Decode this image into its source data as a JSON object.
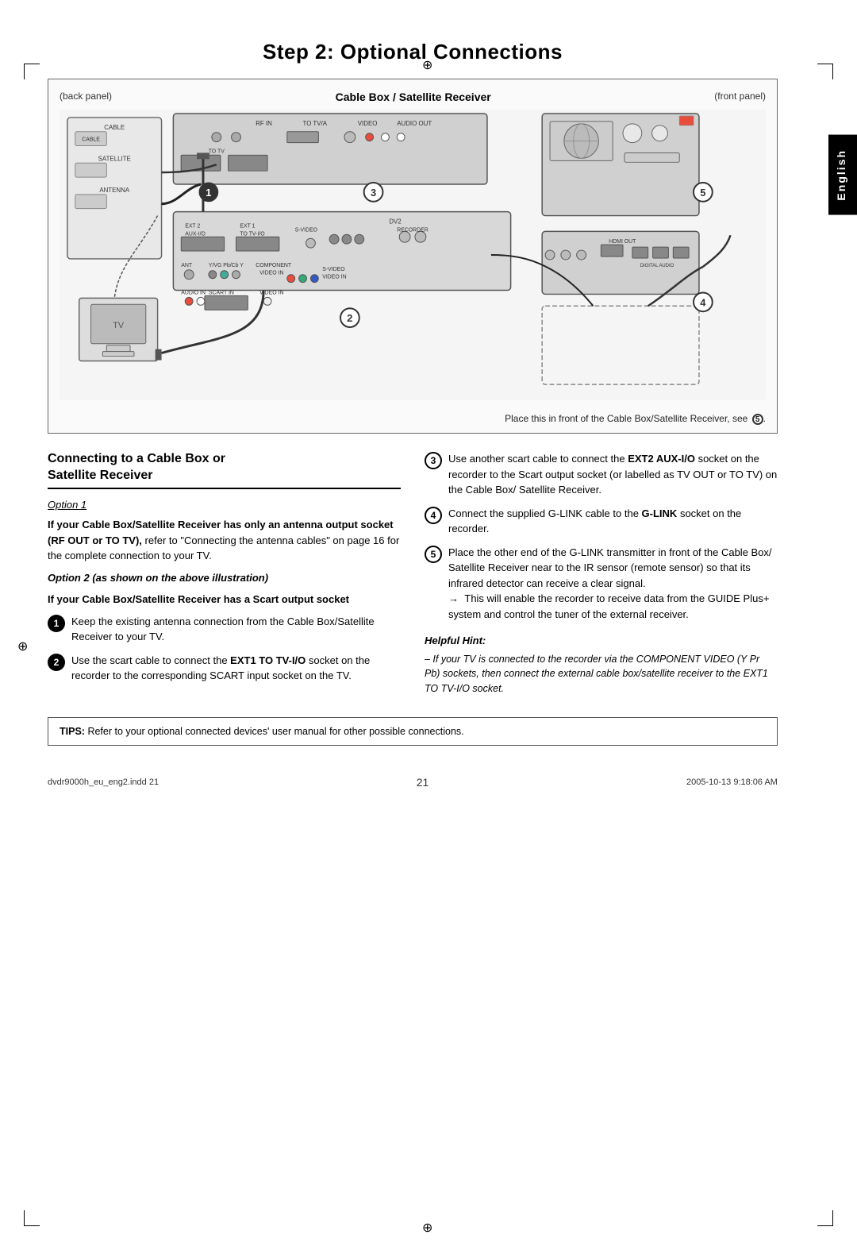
{
  "page": {
    "title": "Step 2: Optional Connections",
    "number": "21",
    "english_tab": "English"
  },
  "diagram": {
    "back_panel_label": "(back panel)",
    "front_panel_label": "(front panel)",
    "cable_box_label": "Cable Box / Satellite Receiver",
    "caption_line1": "Place this in front of the",
    "caption_line2": "Cable Box/Satellite Receiver, see",
    "caption_num": "5"
  },
  "section": {
    "heading_line1": "Connecting to a Cable Box or",
    "heading_line2": "Satellite Receiver"
  },
  "option1": {
    "label": "Option 1",
    "intro_bold": "If your Cable Box/Satellite Receiver has only an antenna output socket (RF OUT or TO TV),",
    "intro_text": "refer to \"Connecting the antenna cables\" on page 16 for the complete connection to your TV."
  },
  "option2": {
    "label": "Option 2 (as shown on the above illustration)",
    "intro_bold": "If your Cable Box/Satellite Receiver has a Scart output socket"
  },
  "steps_left": [
    {
      "num": "1",
      "text": "Keep the existing antenna connection from the Cable Box/Satellite Receiver to your TV."
    },
    {
      "num": "2",
      "text_before": "Use the scart cable to connect the ",
      "bold": "EXT1 TO TV-I/O",
      "text_after": " socket on the recorder to the corresponding SCART input socket on the TV."
    }
  ],
  "steps_right": [
    {
      "num": "3",
      "text_before": "Use another scart cable to connect the ",
      "bold": "EXT2 AUX-I/O",
      "text_after": " socket on the recorder to the Scart output socket (or labelled as TV OUT or TO TV) on the Cable Box/ Satellite Receiver."
    },
    {
      "num": "4",
      "text_before": "Connect the supplied G-LINK cable to the ",
      "bold": "G-LINK",
      "text_after": " socket on the recorder."
    },
    {
      "num": "5",
      "text_main": "Place the other end of the G-LINK transmitter in front of the Cable Box/ Satellite Receiver near to the IR sensor (remote sensor) so that its infrared detector can receive a clear signal.",
      "arrow_text": "This will enable the recorder to receive data from the GUIDE Plus+ system and control the tuner of the external receiver."
    }
  ],
  "helpful_hint": {
    "title": "Helpful Hint:",
    "text": "– If your TV is connected to the recorder via the COMPONENT VIDEO (Y Pr Pb) sockets, then connect the external cable box/satellite receiver to the EXT1 TO TV-I/O socket."
  },
  "tips": {
    "label": "TIPS:",
    "text": "Refer to your optional connected devices' user manual for other possible connections."
  },
  "footer": {
    "left": "dvdr9000h_eu_eng2.indd  21",
    "right": "2005-10-13  9:18:06 AM"
  }
}
